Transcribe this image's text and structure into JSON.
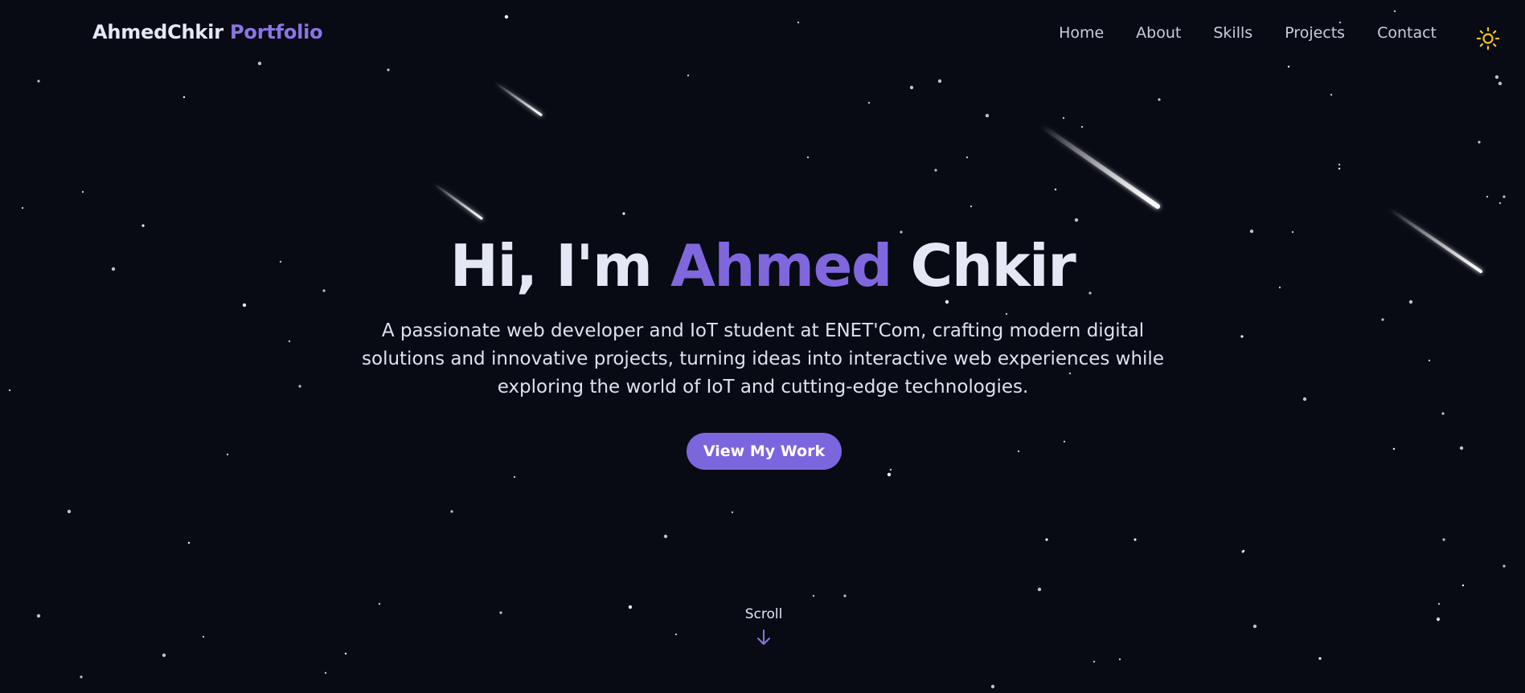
{
  "brand": {
    "name": "AhmedChkir",
    "accent": "Portfolio"
  },
  "nav": {
    "items": [
      {
        "label": "Home"
      },
      {
        "label": "About"
      },
      {
        "label": "Skills"
      },
      {
        "label": "Projects"
      },
      {
        "label": "Contact"
      }
    ],
    "theme_toggle_icon": "sun-icon"
  },
  "hero": {
    "greeting": "Hi, I'm",
    "first_name": "Ahmed",
    "last_name": "Chkir",
    "description": "A passionate web developer and IoT student at ENET'Com, crafting modern digital solutions and innovative projects, turning ideas into interactive web experiences while exploring the world of IoT and cutting-edge technologies.",
    "cta_label": "View My Work",
    "scroll_label": "Scroll",
    "scroll_icon": "arrow-down-icon"
  },
  "colors": {
    "background": "#080b14",
    "accent": "#7c66dd",
    "text": "#e2e6f1",
    "sun": "#f5c518"
  }
}
